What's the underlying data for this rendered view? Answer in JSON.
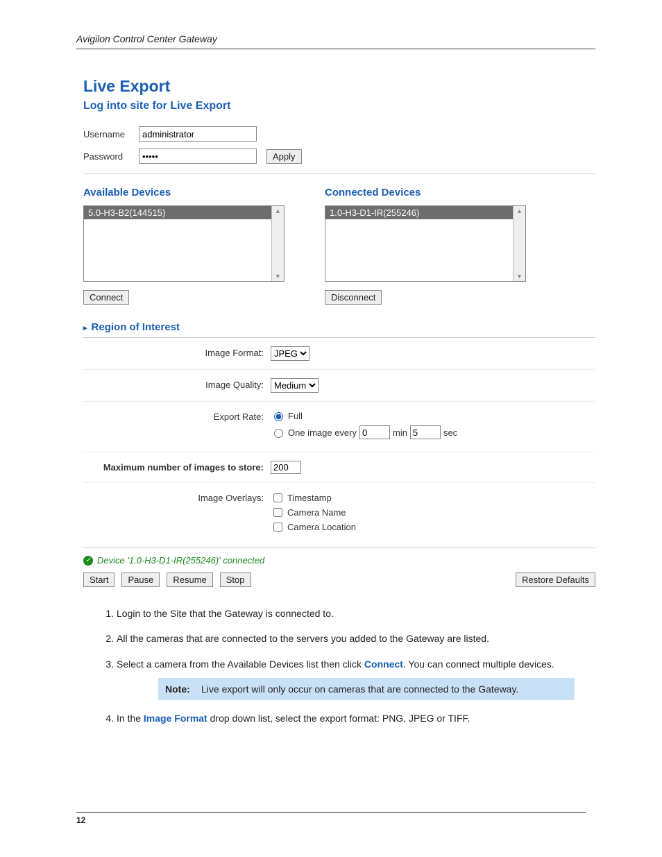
{
  "doc_header": "Avigilon Control Center Gateway",
  "page_number": "12",
  "headings": {
    "main": "Live Export",
    "login": "Log into site for Live Export",
    "available": "Available Devices",
    "connected": "Connected Devices",
    "roi": "Region of Interest"
  },
  "login": {
    "username_label": "Username",
    "username_value": "administrator",
    "password_label": "Password",
    "password_value": "•••••",
    "apply": "Apply"
  },
  "devices": {
    "available_item": "5.0-H3-B2(144515)",
    "connected_item": "1.0-H3-D1-IR(255246)",
    "connect": "Connect",
    "disconnect": "Disconnect"
  },
  "settings": {
    "image_format_label": "Image Format:",
    "image_format_value": "JPEG",
    "image_quality_label": "Image Quality:",
    "image_quality_value": "Medium",
    "export_rate_label": "Export Rate:",
    "rate_full": "Full",
    "rate_one_image": "One image every",
    "rate_min_val": "0",
    "rate_min_unit": "min",
    "rate_sec_val": "5",
    "rate_sec_unit": "sec",
    "max_images_label": "Maximum number of images to store:",
    "max_images_value": "200",
    "overlays_label": "Image Overlays:",
    "overlay_timestamp": "Timestamp",
    "overlay_camera_name": "Camera Name",
    "overlay_camera_location": "Camera Location"
  },
  "status_text": "Device '1.0-H3-D1-IR(255246)' connected",
  "buttons": {
    "start": "Start",
    "pause": "Pause",
    "resume": "Resume",
    "stop": "Stop",
    "restore": "Restore Defaults"
  },
  "steps": {
    "s1": "Login to the Site that the Gateway is connected to.",
    "s2": "All the cameras that are connected to the servers you added to the Gateway are listed.",
    "s3_a": "Select a camera from the Available Devices list then click ",
    "s3_kw": "Connect",
    "s3_b": ". You can connect multiple devices.",
    "note_label": "Note:",
    "note_text": "Live export will only occur on cameras that are connected to the Gateway.",
    "s4_a": "In the ",
    "s4_kw": "Image Format",
    "s4_b": " drop down list, select the export format: PNG, JPEG or TIFF."
  }
}
